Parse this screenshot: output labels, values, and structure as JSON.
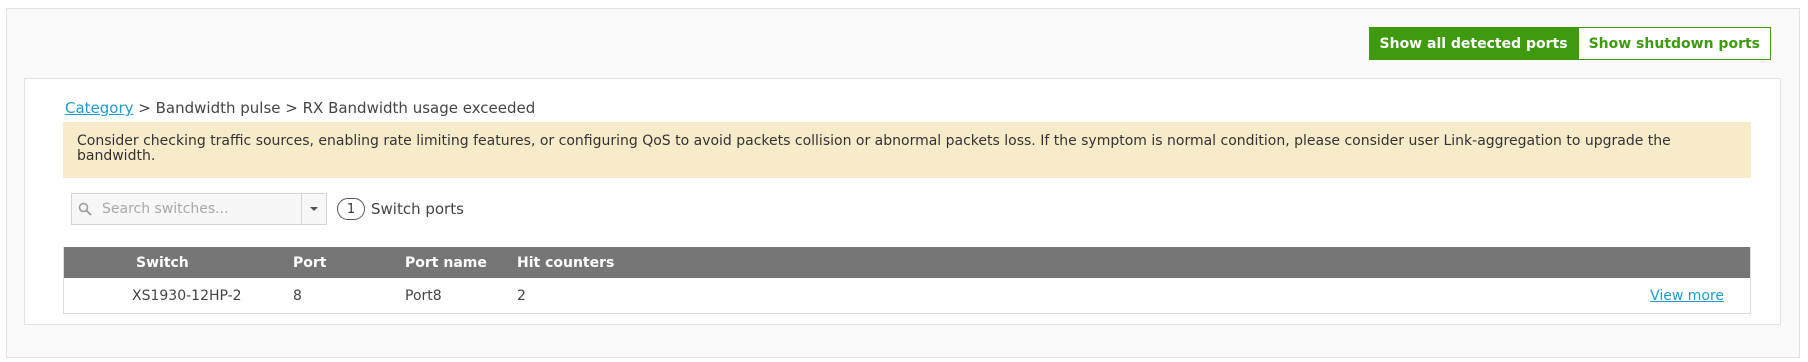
{
  "header": {
    "show_all_label": "Show all detected ports",
    "show_shutdown_label": "Show shutdown ports"
  },
  "breadcrumb": {
    "root_link": "Category",
    "trail": " > Bandwidth pulse > RX Bandwidth usage exceeded"
  },
  "alert": {
    "message": "Consider checking traffic sources, enabling rate limiting features, or configuring QoS to avoid packets collision or abnormal packets loss. If the symptom is normal condition, please consider user Link-aggregation to upgrade the bandwidth."
  },
  "search": {
    "placeholder": "Search switches...",
    "value": "",
    "icon": "search-icon"
  },
  "count": {
    "value": "1",
    "label": "Switch ports"
  },
  "table": {
    "columns": [
      "Switch",
      "Port",
      "Port name",
      "Hit counters"
    ],
    "rows": [
      {
        "switch": "XS1930-12HP-2",
        "port": "8",
        "port_name": "Port8",
        "hits": "2",
        "action": "View more"
      }
    ]
  },
  "colors": {
    "accent_green": "#3f9a10",
    "link_blue": "#1f9bd1",
    "alert_bg": "#f8ebca",
    "table_header_bg": "#767676"
  }
}
